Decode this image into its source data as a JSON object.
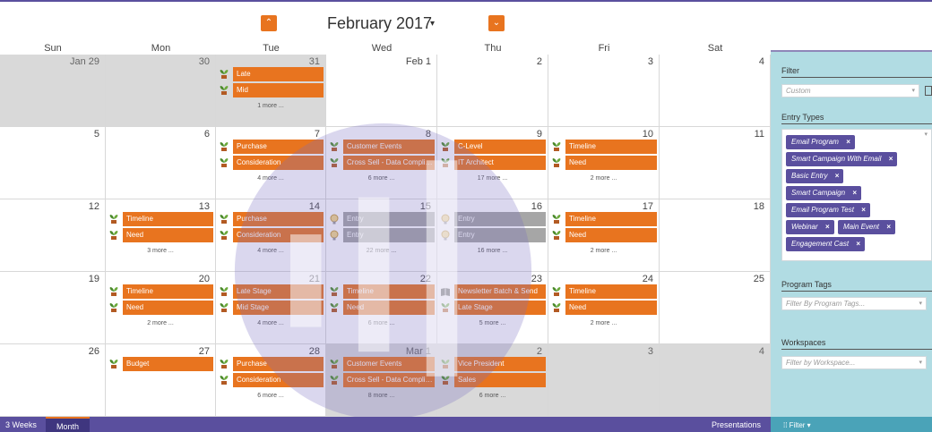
{
  "header": {
    "month_title": "February 2017",
    "month_caret": "▾",
    "prev_icon": "⌃",
    "next_icon": "⌄"
  },
  "days_of_week": [
    "Sun",
    "Mon",
    "Tue",
    "Wed",
    "Thu",
    "Fri",
    "Sat"
  ],
  "weeks": [
    [
      {
        "date": "Jan 29",
        "out": true,
        "events": [],
        "more": ""
      },
      {
        "date": "30",
        "out": true,
        "events": [],
        "more": ""
      },
      {
        "date": "31",
        "out": true,
        "events": [
          {
            "label": "Late",
            "icon": "plant"
          },
          {
            "label": "Mid",
            "icon": "plant"
          }
        ],
        "more": "1 more ..."
      },
      {
        "date": "Feb 1",
        "out": false,
        "events": [],
        "more": ""
      },
      {
        "date": "2",
        "out": false,
        "events": [],
        "more": ""
      },
      {
        "date": "3",
        "out": false,
        "events": [],
        "more": ""
      },
      {
        "date": "4",
        "out": false,
        "events": [],
        "more": ""
      }
    ],
    [
      {
        "date": "5",
        "out": false,
        "events": [],
        "more": ""
      },
      {
        "date": "6",
        "out": false,
        "events": [],
        "more": ""
      },
      {
        "date": "7",
        "out": false,
        "events": [
          {
            "label": "Purchase",
            "icon": "plant"
          },
          {
            "label": "Consideration",
            "icon": "plant"
          }
        ],
        "more": "4 more ..."
      },
      {
        "date": "8",
        "out": false,
        "events": [
          {
            "label": "Customer Events",
            "icon": "plant"
          },
          {
            "label": "Cross Sell - Data Complian...",
            "icon": "plant"
          }
        ],
        "more": "6 more ..."
      },
      {
        "date": "9",
        "out": false,
        "events": [
          {
            "label": "C-Level",
            "icon": "plant"
          },
          {
            "label": "IT Architect",
            "icon": "plant"
          }
        ],
        "more": "17 more ..."
      },
      {
        "date": "10",
        "out": false,
        "events": [
          {
            "label": "Timeline",
            "icon": "plant"
          },
          {
            "label": "Need",
            "icon": "plant"
          }
        ],
        "more": "2 more ..."
      },
      {
        "date": "11",
        "out": false,
        "events": [],
        "more": ""
      }
    ],
    [
      {
        "date": "12",
        "out": false,
        "events": [],
        "more": ""
      },
      {
        "date": "13",
        "out": false,
        "events": [
          {
            "label": "Timeline",
            "icon": "plant"
          },
          {
            "label": "Need",
            "icon": "plant"
          }
        ],
        "more": "3 more ..."
      },
      {
        "date": "14",
        "out": false,
        "events": [
          {
            "label": "Purchase",
            "icon": "plant"
          },
          {
            "label": "Consideration",
            "icon": "plant"
          }
        ],
        "more": "4 more ..."
      },
      {
        "date": "15",
        "out": false,
        "events": [
          {
            "label": "Entry",
            "icon": "bulb",
            "gray": true
          },
          {
            "label": "Entry",
            "icon": "bulb",
            "gray": true
          }
        ],
        "more": "22 more ..."
      },
      {
        "date": "16",
        "out": false,
        "events": [
          {
            "label": "Entry",
            "icon": "bulb",
            "gray": true
          },
          {
            "label": "Entry",
            "icon": "bulb",
            "gray": true
          }
        ],
        "more": "16 more ..."
      },
      {
        "date": "17",
        "out": false,
        "events": [
          {
            "label": "Timeline",
            "icon": "plant"
          },
          {
            "label": "Need",
            "icon": "plant"
          }
        ],
        "more": "2 more ..."
      },
      {
        "date": "18",
        "out": false,
        "events": [],
        "more": ""
      }
    ],
    [
      {
        "date": "19",
        "out": false,
        "events": [],
        "more": ""
      },
      {
        "date": "20",
        "out": false,
        "events": [
          {
            "label": "Timeline",
            "icon": "plant"
          },
          {
            "label": "Need",
            "icon": "plant"
          }
        ],
        "more": "2 more ..."
      },
      {
        "date": "21",
        "out": false,
        "events": [
          {
            "label": "Late Stage",
            "icon": "plant"
          },
          {
            "label": "Mid Stage",
            "icon": "plant"
          }
        ],
        "more": "4 more ..."
      },
      {
        "date": "22",
        "out": false,
        "events": [
          {
            "label": "Timeline",
            "icon": "plant"
          },
          {
            "label": "Need",
            "icon": "plant"
          }
        ],
        "more": "6 more ..."
      },
      {
        "date": "23",
        "out": false,
        "events": [
          {
            "label": "Newsletter Batch & Send",
            "icon": "book"
          },
          {
            "label": "Late Stage",
            "icon": "plant"
          }
        ],
        "more": "5 more ..."
      },
      {
        "date": "24",
        "out": false,
        "events": [
          {
            "label": "Timeline",
            "icon": "plant"
          },
          {
            "label": "Need",
            "icon": "plant"
          }
        ],
        "more": "2 more ..."
      },
      {
        "date": "25",
        "out": false,
        "events": [],
        "more": ""
      }
    ],
    [
      {
        "date": "26",
        "out": false,
        "events": [],
        "more": ""
      },
      {
        "date": "27",
        "out": false,
        "events": [
          {
            "label": "Budget",
            "icon": "plant"
          }
        ],
        "more": ""
      },
      {
        "date": "28",
        "out": false,
        "events": [
          {
            "label": "Purchase",
            "icon": "plant"
          },
          {
            "label": "Consideration",
            "icon": "plant"
          }
        ],
        "more": "6 more ..."
      },
      {
        "date": "Mar 1",
        "out": true,
        "events": [
          {
            "label": "Customer Events",
            "icon": "plant"
          },
          {
            "label": "Cross Sell - Data Complian...",
            "icon": "plant"
          }
        ],
        "more": "8 more ..."
      },
      {
        "date": "2",
        "out": true,
        "events": [
          {
            "label": "Vice President",
            "icon": "plant"
          },
          {
            "label": "Sales",
            "icon": "plant"
          }
        ],
        "more": "6 more ..."
      },
      {
        "date": "3",
        "out": true,
        "events": [],
        "more": ""
      },
      {
        "date": "4",
        "out": true,
        "events": [],
        "more": ""
      }
    ]
  ],
  "bottom_bar": {
    "three_weeks": "3 Weeks",
    "month": "Month",
    "presentations": "Presentations"
  },
  "panel": {
    "filter_label": "Filter",
    "filter_placeholder": "Custom",
    "entry_types_label": "Entry Types",
    "entry_types": [
      "Email Program",
      "Smart Campaign With Email",
      "Basic Entry",
      "Smart Campaign",
      "Email Program Test",
      "Webinar",
      "Main Event",
      "Engagement Cast"
    ],
    "program_tags_label": "Program Tags",
    "program_tags_placeholder": "Filter By Program Tags...",
    "workspaces_label": "Workspaces",
    "workspaces_placeholder": "Filter by Workspace...",
    "footer_label": "Filter"
  },
  "colors": {
    "accent": "#e8741f",
    "brand": "#5a4f9e",
    "panel": "#b1dce3",
    "gray_event": "#a6a6a6"
  }
}
